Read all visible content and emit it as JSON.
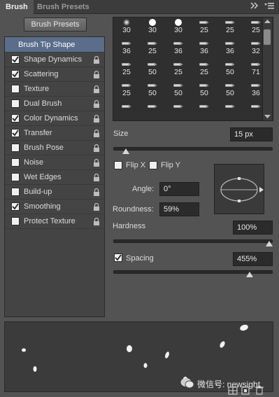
{
  "tabs": {
    "active": "Brush",
    "inactive": "Brush Presets"
  },
  "buttons": {
    "brush_presets": "Brush Presets"
  },
  "left_list": {
    "header": "Brush Tip Shape",
    "items": [
      {
        "label": "Shape Dynamics",
        "checked": true
      },
      {
        "label": "Scattering",
        "checked": true
      },
      {
        "label": "Texture",
        "checked": false
      },
      {
        "label": "Dual Brush",
        "checked": false
      },
      {
        "label": "Color Dynamics",
        "checked": true
      },
      {
        "label": "Transfer",
        "checked": true
      },
      {
        "label": "Brush Pose",
        "checked": false
      },
      {
        "label": "Noise",
        "checked": false
      },
      {
        "label": "Wet Edges",
        "checked": false
      },
      {
        "label": "Build-up",
        "checked": false
      },
      {
        "label": "Smoothing",
        "checked": true
      },
      {
        "label": "Protect Texture",
        "checked": false
      }
    ]
  },
  "brush_grid": {
    "rows": [
      [
        "30",
        "30",
        "30",
        "25",
        "25",
        "25"
      ],
      [
        "36",
        "25",
        "36",
        "36",
        "36",
        "32"
      ],
      [
        "25",
        "50",
        "25",
        "25",
        "50",
        "71"
      ],
      [
        "25",
        "50",
        "50",
        "50",
        "50",
        "36"
      ],
      [
        "",
        "",
        "",
        "",
        "",
        ""
      ]
    ]
  },
  "size": {
    "label": "Size",
    "value": "15 px",
    "level": 0.06
  },
  "flip": {
    "x_label": "Flip X",
    "y_label": "Flip Y",
    "x_checked": false,
    "y_checked": false
  },
  "angle": {
    "label": "Angle:",
    "value": "0°"
  },
  "roundness": {
    "label": "Roundness:",
    "value": "59%"
  },
  "hardness": {
    "label": "Hardness",
    "value": "100%",
    "level": 1.0
  },
  "spacing": {
    "label": "Spacing",
    "value": "455%",
    "checked": true,
    "level": 0.87
  },
  "watermark": "微信号: newsight"
}
